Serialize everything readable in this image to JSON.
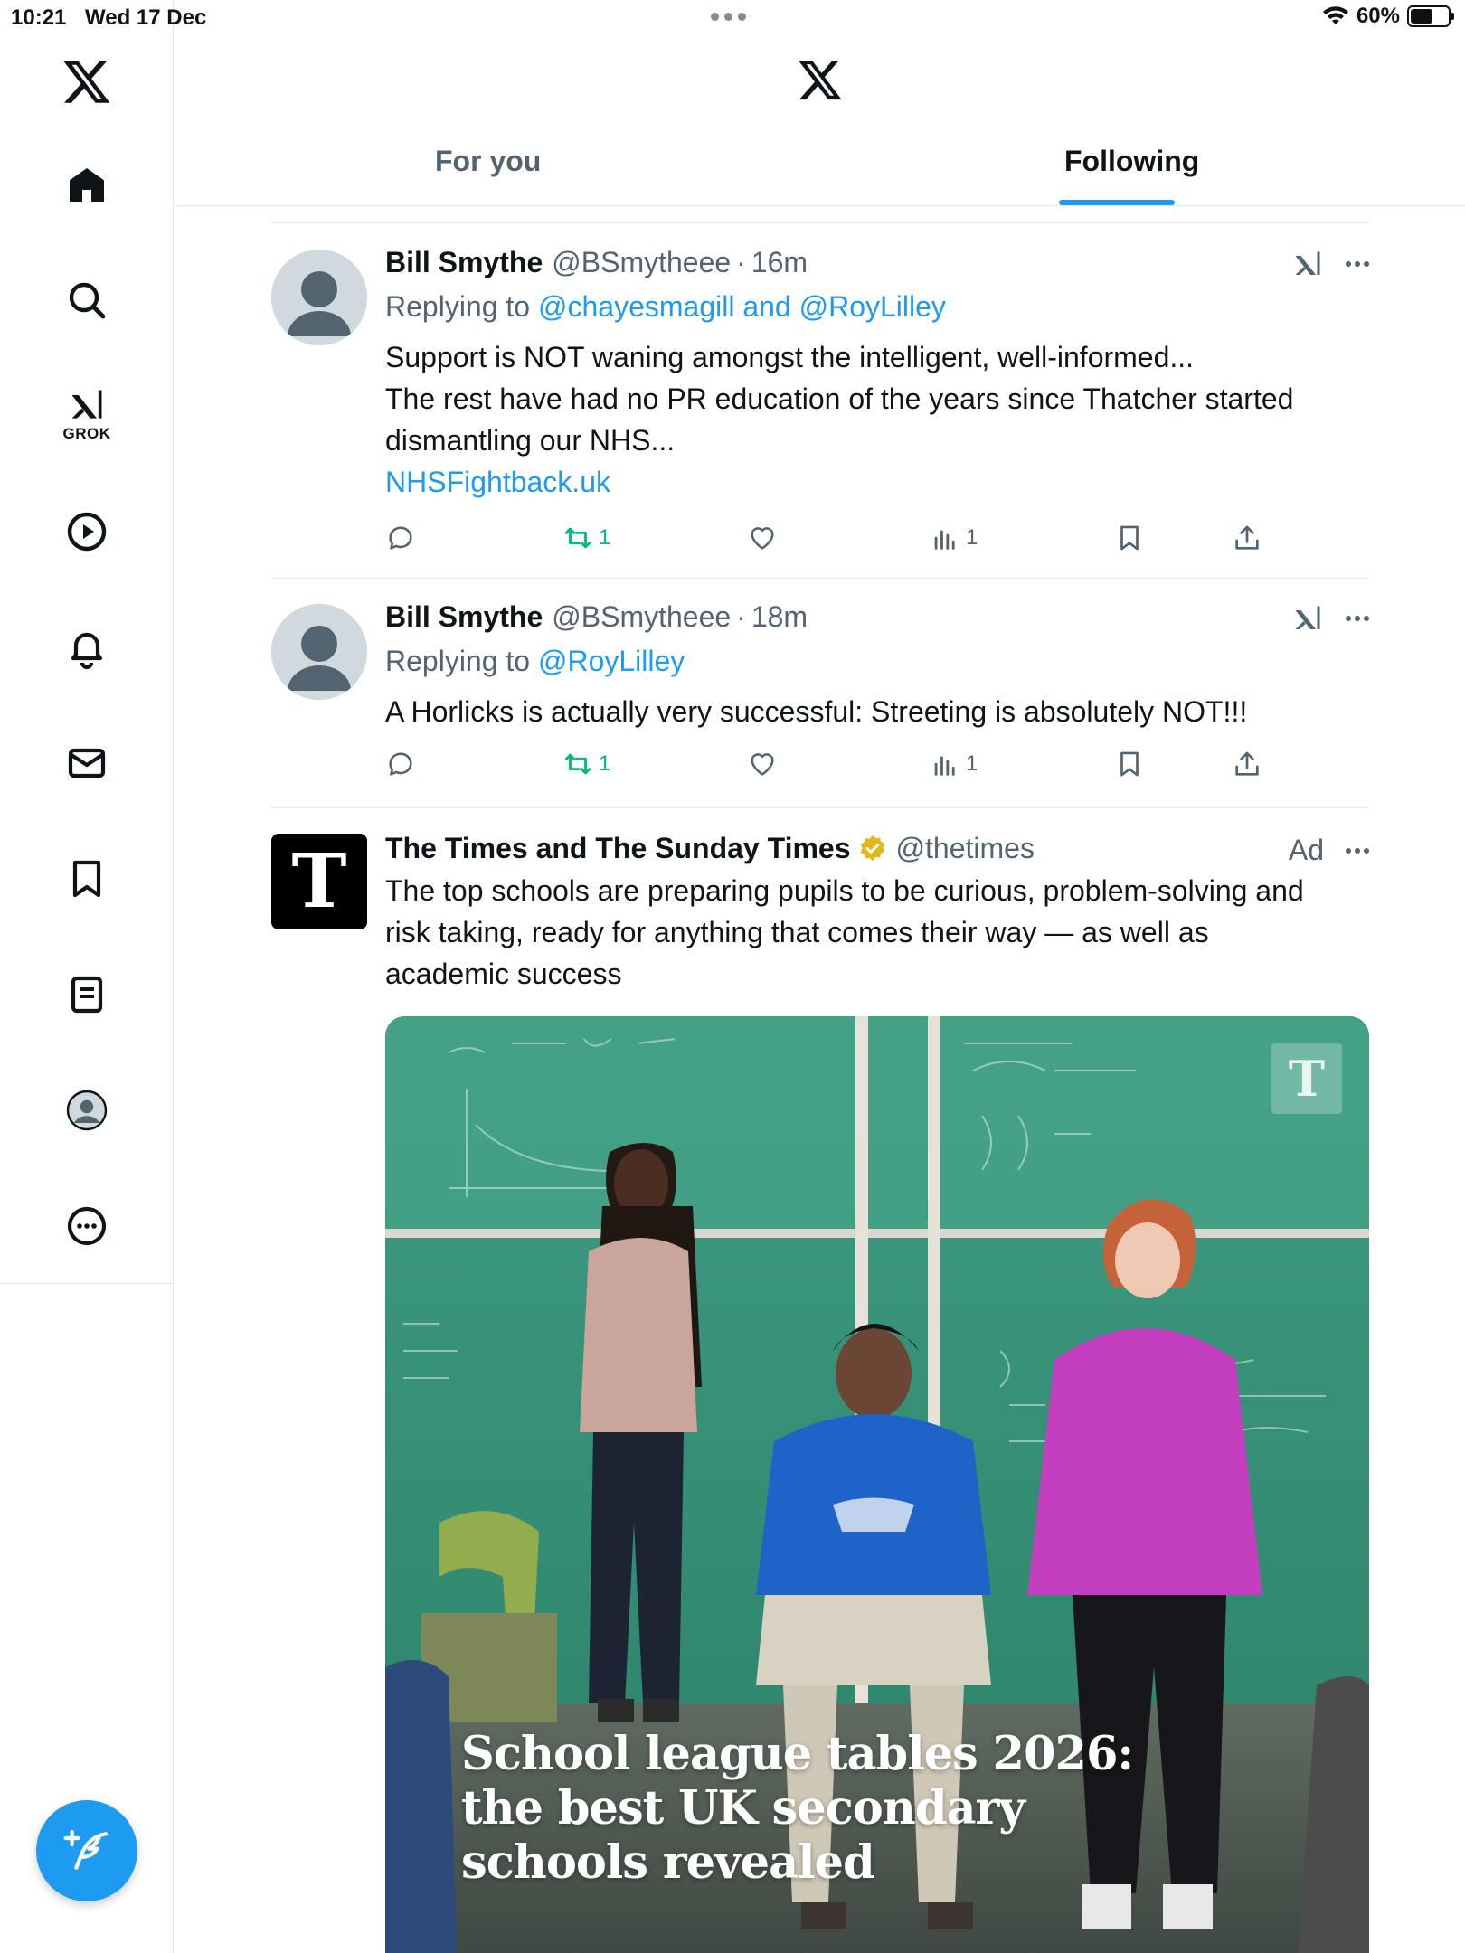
{
  "status_bar": {
    "time": "10:21",
    "date": "Wed 17 Dec",
    "battery": "60%",
    "battery_level": 0.6
  },
  "sidebar": {
    "items": [
      {
        "name": "home",
        "icon": "home-icon"
      },
      {
        "name": "explore",
        "icon": "search-icon"
      },
      {
        "name": "grok",
        "icon": "grok-icon",
        "label": "GROK"
      },
      {
        "name": "video",
        "icon": "play-icon"
      },
      {
        "name": "notifications",
        "icon": "bell-icon"
      },
      {
        "name": "messages",
        "icon": "mail-icon"
      },
      {
        "name": "bookmarks",
        "icon": "bookmark-icon"
      },
      {
        "name": "lists",
        "icon": "list-icon"
      },
      {
        "name": "profile",
        "icon": "avatar-icon"
      },
      {
        "name": "more",
        "icon": "more-icon"
      }
    ],
    "compose_icon": "compose-icon"
  },
  "header": {
    "tabs": [
      {
        "label": "For you",
        "active": false
      },
      {
        "label": "Following",
        "active": true
      }
    ]
  },
  "colors": {
    "accent": "#1d9bf0",
    "retweet": "#00ba7c",
    "text": "#0f1419",
    "secondary": "#536471"
  },
  "tweets": [
    {
      "name": "Bill Smythe",
      "handle": "@BSmytheee",
      "time": "16m",
      "replying_prefix": "Replying to ",
      "replying_to": "@chayesmagill and @RoyLilley",
      "lines": [
        "Support is NOT waning amongst the intelligent, well-informed...",
        "The rest have had no PR education of the years since Thatcher started",
        "dismantling our NHS..."
      ],
      "link": "NHSFightback.uk",
      "retweets": "1",
      "views": "1"
    },
    {
      "name": "Bill Smythe",
      "handle": "@BSmytheee",
      "time": "18m",
      "replying_prefix": "Replying to ",
      "replying_to": "@RoyLilley",
      "lines": [
        "A Horlicks is actually very successful: Streeting is absolutely NOT!!!"
      ],
      "retweets": "1",
      "views": "1"
    }
  ],
  "ad": {
    "logo_letter": "T",
    "name": "The Times and The Sunday Times",
    "handle": "@thetimes",
    "ad_label": "Ad",
    "lines": [
      "The top schools are preparing pupils to be curious, problem-solving and",
      "risk taking, ready for anything that comes their way — as well as",
      "academic success"
    ],
    "image_headline": [
      "School league tables 2026:",
      "the best UK secondary",
      "schools revealed"
    ],
    "image_watermark": "T"
  }
}
